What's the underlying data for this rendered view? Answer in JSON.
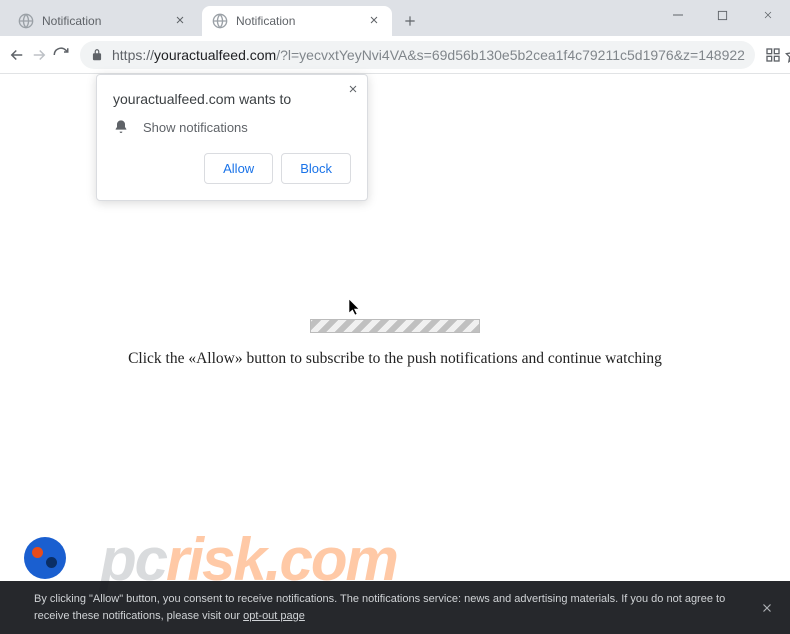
{
  "tabs": [
    {
      "title": "Notification",
      "active": false
    },
    {
      "title": "Notification",
      "active": true
    }
  ],
  "url": {
    "protocol": "https://",
    "host": "youractualfeed.com",
    "path": "/?l=yecvxtYeyNvi4VA&s=69d56b130e5b2cea1f4c79211c5d1976&z=148922"
  },
  "permission": {
    "title": "youractualfeed.com wants to",
    "item": "Show notifications",
    "allow": "Allow",
    "block": "Block"
  },
  "page": {
    "instruction": "Click the «Allow» button to subscribe to the push notifications and continue watching"
  },
  "watermark": {
    "pc": "pc",
    "risk": "risk.com"
  },
  "consent": {
    "text": "By clicking \"Allow\" button, you consent to receive notifications. The notifications service: news and advertising materials. If you do not agree to receive these notifications, please visit our ",
    "link": "opt-out page"
  }
}
